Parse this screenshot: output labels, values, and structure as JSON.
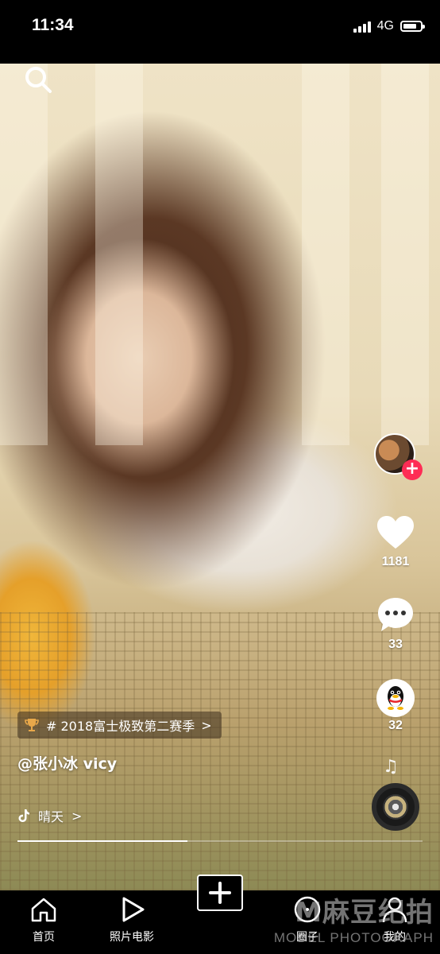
{
  "status_bar": {
    "time": "11:34",
    "network": "4G",
    "battery_level": 0.8
  },
  "video": {
    "tag": "# 2018富士极致第二赛季",
    "tag_chevron": ">",
    "username": "@张小冰 vicy",
    "music_title": "晴天",
    "music_chevron": ">",
    "progress": 0.42
  },
  "actions": {
    "follow_symbol": "+",
    "likes": "1181",
    "comments": "33",
    "shares": "32"
  },
  "nav": {
    "items": [
      {
        "label": "首页",
        "icon": "home-icon"
      },
      {
        "label": "照片电影",
        "icon": "play-icon"
      },
      {
        "label": "",
        "icon": "add-icon"
      },
      {
        "label": "圈子",
        "icon": "circle-icon"
      },
      {
        "label": "我的",
        "icon": "profile-icon"
      }
    ]
  },
  "watermark": {
    "main": "M麻豆纪拍",
    "sub": "MODEL PHOTOGRAPH"
  },
  "colors": {
    "accent": "#fe2c55",
    "background": "#000000"
  }
}
